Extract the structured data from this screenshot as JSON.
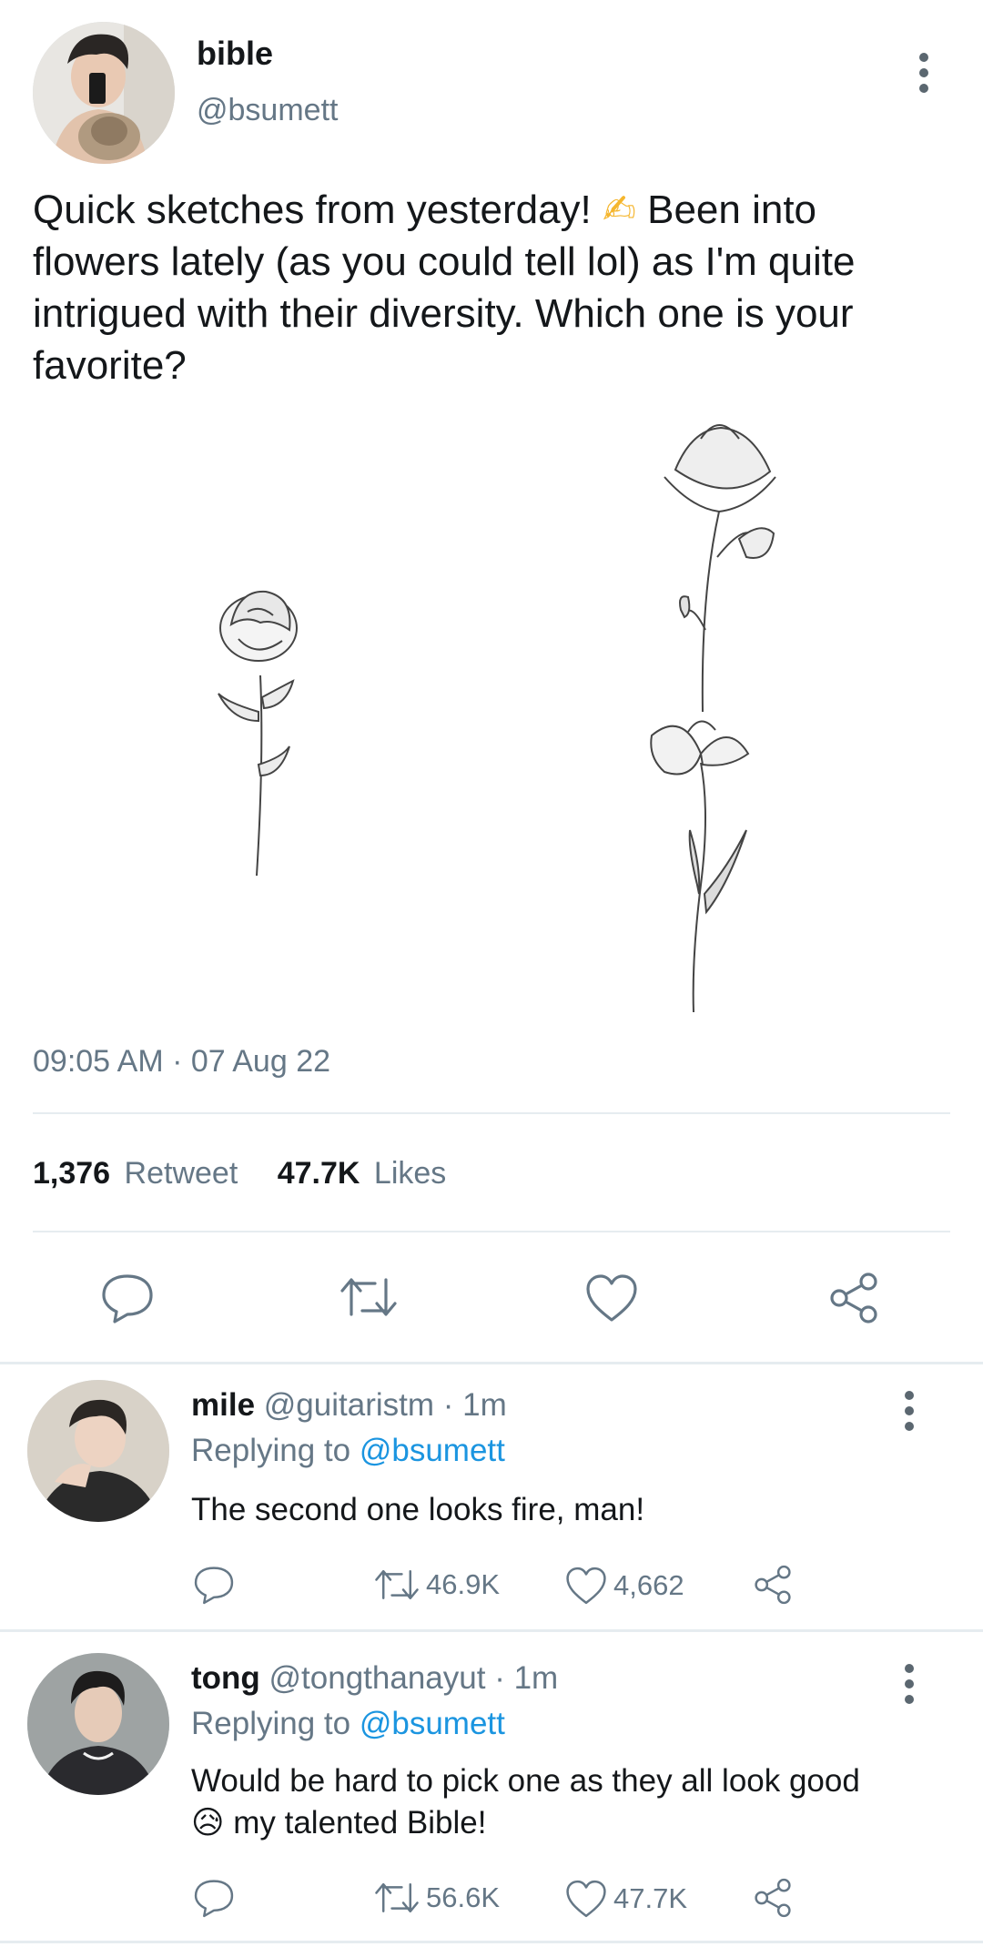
{
  "tweet": {
    "display_name": "bible",
    "handle": "@bsumett",
    "text_part1": "Quick sketches from yesterday! ",
    "emoji_writing": "✍",
    "text_part2": " Been into flowers lately (as you could tell lol) as I'm quite intrigued with their diversity. Which one is your favorite?",
    "timestamp": "09:05 AM · 07 Aug 22",
    "retweet_count": "1,376",
    "retweet_label": "Retweet",
    "likes_count": "47.7K",
    "likes_label": "Likes"
  },
  "icons": {
    "more": "more-vertical-icon",
    "reply": "reply-icon",
    "retweet": "retweet-icon",
    "like": "heart-icon",
    "share": "share-icon"
  },
  "replies": [
    {
      "display_name": "mile",
      "handle": "@guitaristm",
      "time": "· 1m",
      "replying_prefix": "Replying to",
      "replying_handle": "@bsumett",
      "text": "The second one looks fire, man!",
      "emoji": "",
      "text_after_emoji": "",
      "retweets": "46.9K",
      "likes": "4,662"
    },
    {
      "display_name": "tong",
      "handle": "@tongthanayut",
      "time": "· 1m",
      "replying_prefix": "Replying to",
      "replying_handle": "@bsumett",
      "text": "Would be hard to pick one as they all look good",
      "emoji": "😥",
      "text_after_emoji": " my talented Bible!",
      "retweets": "56.6K",
      "likes": "47.7K"
    }
  ],
  "colors": {
    "accent": "#1b95e0",
    "muted": "#657786",
    "text": "#14171a",
    "divider": "#e6ecf0"
  }
}
